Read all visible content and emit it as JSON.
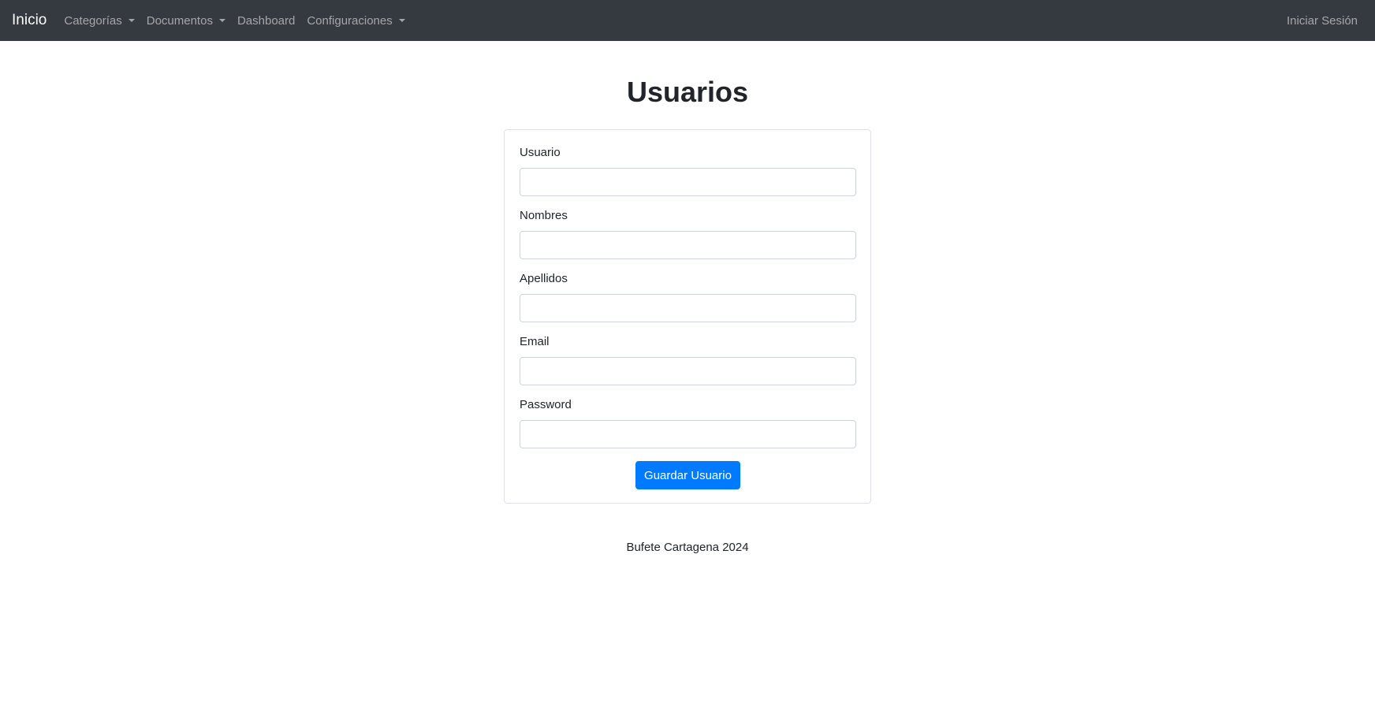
{
  "navbar": {
    "brand": "Inicio",
    "items": [
      {
        "label": "Categorías",
        "dropdown": true
      },
      {
        "label": "Documentos",
        "dropdown": true
      },
      {
        "label": "Dashboard",
        "dropdown": false
      },
      {
        "label": "Configuraciones",
        "dropdown": true
      }
    ],
    "login_label": "Iniciar Sesión",
    "background_color": "#343a40"
  },
  "main": {
    "title": "Usuarios",
    "form": {
      "fields": [
        {
          "label": "Usuario",
          "value": ""
        },
        {
          "label": "Nombres",
          "value": ""
        },
        {
          "label": "Apellidos",
          "value": ""
        },
        {
          "label": "Email",
          "value": ""
        },
        {
          "label": "Password",
          "value": ""
        }
      ],
      "submit_label": "Guardar Usuario",
      "submit_color": "#007bff"
    }
  },
  "footer": {
    "text": "Bufete Cartagena 2024"
  }
}
